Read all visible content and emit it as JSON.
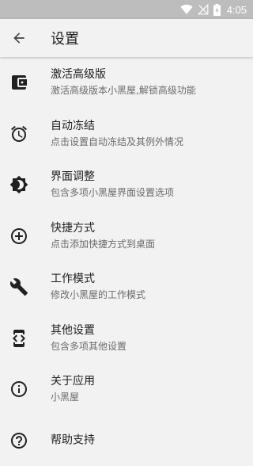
{
  "status_bar": {
    "time": "4:05",
    "icons": [
      "wifi-icon",
      "signal-off-icon",
      "battery-charging-icon"
    ]
  },
  "app_bar": {
    "back_icon": "arrow-back-icon",
    "title": "设置"
  },
  "settings": {
    "items": [
      {
        "icon": "wallet-icon",
        "title": "激活高级版",
        "subtitle": "激活高级版本小黑屋,解锁高级功能"
      },
      {
        "icon": "alarm-icon",
        "title": "自动冻结",
        "subtitle": "点击设置自动冻结及其例外情况"
      },
      {
        "icon": "brightness-icon",
        "title": "界面调整",
        "subtitle": "包含多项小黑屋界面设置选项"
      },
      {
        "icon": "add-circle-icon",
        "title": "快捷方式",
        "subtitle": "点击添加快捷方式到桌面"
      },
      {
        "icon": "wrench-icon",
        "title": "工作模式",
        "subtitle": "修改小黑屋的工作模式"
      },
      {
        "icon": "developer-mode-icon",
        "title": "其他设置",
        "subtitle": "包含多项其他设置"
      },
      {
        "icon": "info-icon",
        "title": "关于应用",
        "subtitle": "小黑屋"
      },
      {
        "icon": "help-icon",
        "title": "帮助支持",
        "subtitle": ""
      }
    ]
  },
  "colors": {
    "background": "#f2f2f2",
    "status_bar": "#bdbdbd",
    "primary_text": "#212121",
    "secondary_text": "#6b6b6b",
    "icon": "#212121"
  }
}
